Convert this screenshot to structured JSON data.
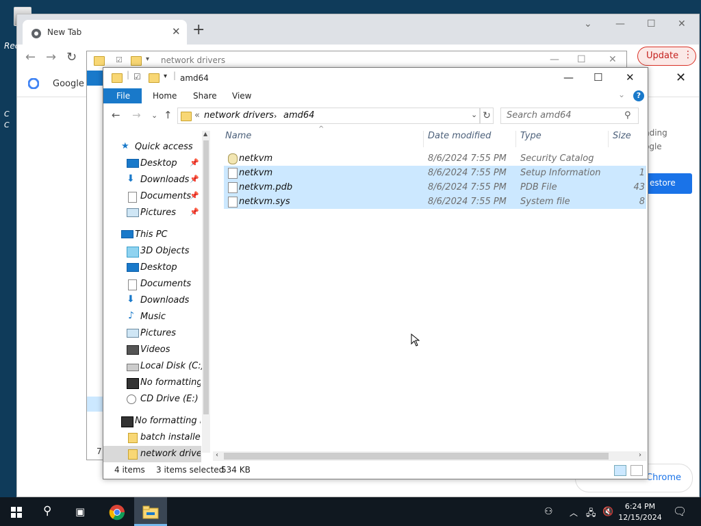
{
  "desktop": {
    "recycle_label": "Rec",
    "other_labels": [
      "C",
      "C"
    ]
  },
  "chrome": {
    "tab_title": "New Tab",
    "update_label": "Update",
    "bookmark_label": "Google C",
    "right_panel": [
      "nding",
      "ogle"
    ],
    "restore_label": "estore",
    "get_chrome_label": "Chrome"
  },
  "back_explorer": {
    "title": "network drivers",
    "status_count": "7"
  },
  "explorer": {
    "title": "amd64",
    "ribbon_tabs": [
      "File",
      "Home",
      "Share",
      "View"
    ],
    "address": {
      "prefix": "«",
      "parts": [
        "network drivers",
        "amd64"
      ]
    },
    "search_placeholder": "Search amd64",
    "nav": {
      "quick_access": "Quick access",
      "quick_items": [
        "Desktop",
        "Downloads",
        "Documents",
        "Pictures"
      ],
      "this_pc": "This PC",
      "pc_items": [
        "3D Objects",
        "Desktop",
        "Documents",
        "Downloads",
        "Music",
        "Pictures",
        "Videos",
        "Local Disk (C:)",
        "No formatting",
        "CD Drive (E:) v"
      ],
      "drive": "No formatting i",
      "drive_items": [
        "batch installer",
        "network driver"
      ]
    },
    "columns": [
      "Name",
      "Date modified",
      "Type",
      "Size"
    ],
    "files": [
      {
        "name": "netkvm",
        "date": "8/6/2024 7:55 PM",
        "type": "Security Catalog",
        "size": "",
        "selected": false
      },
      {
        "name": "netkvm",
        "date": "8/6/2024 7:55 PM",
        "type": "Setup Information",
        "size": "1",
        "selected": true
      },
      {
        "name": "netkvm.pdb",
        "date": "8/6/2024 7:55 PM",
        "type": "PDB File",
        "size": "43",
        "selected": true
      },
      {
        "name": "netkvm.sys",
        "date": "8/6/2024 7:55 PM",
        "type": "System file",
        "size": "8",
        "selected": true
      }
    ],
    "status": {
      "count": "4 items",
      "selected": "3 items selected",
      "size": "534 KB"
    }
  },
  "taskbar": {
    "time": "6:24 PM",
    "date": "12/15/2024"
  },
  "colors": {
    "accent": "#1979ca",
    "selection": "#cce8ff",
    "taskbar": "#101820"
  }
}
